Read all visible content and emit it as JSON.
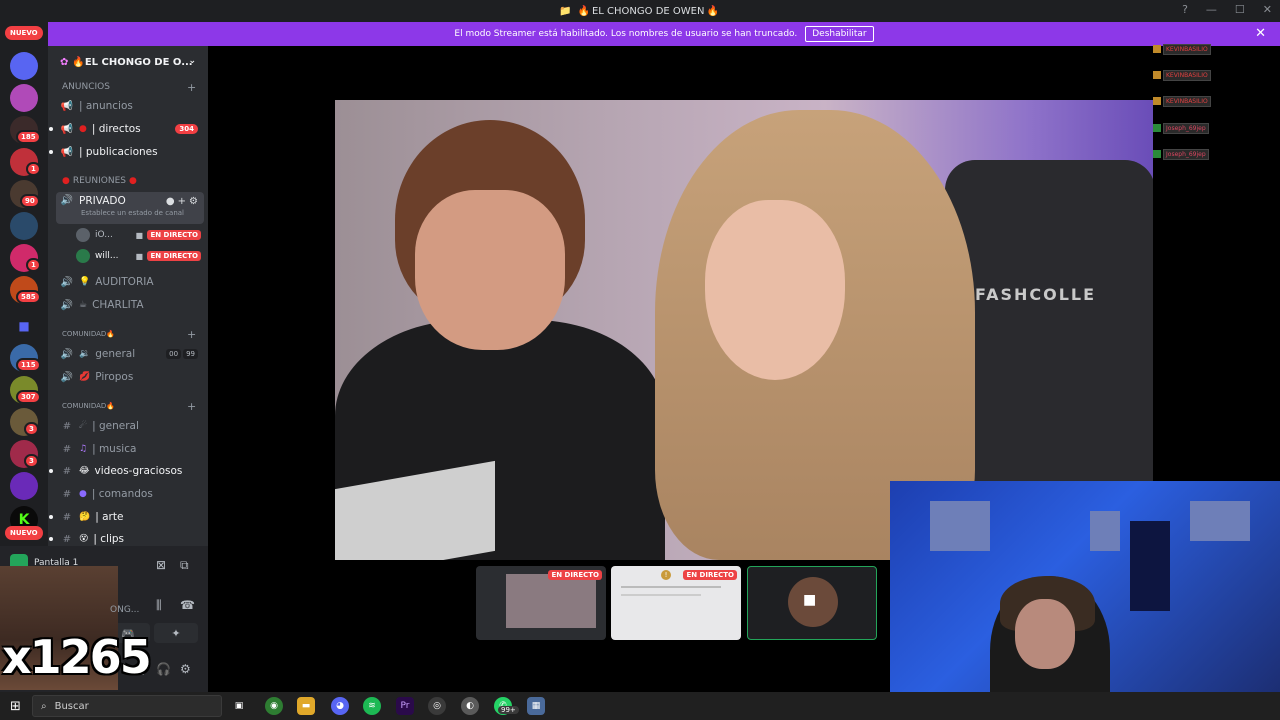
{
  "window": {
    "title": "EL CHONGO DE OWEN"
  },
  "banner": {
    "message": "El modo Streamer está habilitado. Los nombres de usuario se han truncado.",
    "button_label": "Deshabilitar"
  },
  "rail": {
    "nuevo_top": "NUEVO",
    "nuevo_bottom": "NUEVO",
    "badges": [
      "185",
      "1",
      "90",
      "1",
      "585",
      "115",
      "307",
      "3",
      "3"
    ]
  },
  "sidebar": {
    "server_name": "🔥EL CHONGO DE O...",
    "categories": {
      "anuncios": "ANUNCIOS",
      "reuniones": "REUNIONES",
      "comunidad1": "COMUNIDAD🔥",
      "comunidad2": "COMUNIDAD🔥"
    },
    "channels": {
      "anuncios": "| anuncios",
      "directos": "| directos",
      "directos_badge": "304",
      "publicaciones": "| publicaciones",
      "privado": "PRIVADO",
      "privado_status": "Establece un estado de canal",
      "auditoria": "AUDITORIA",
      "charlita": "CHARLITA",
      "general_voice": "general",
      "general_voice_count1": "00",
      "general_voice_count2": "99",
      "piropos": "Piropos",
      "general_text": "| general",
      "musica": "| musica",
      "videos": "videos-graciosos",
      "comandos": "| comandos",
      "arte": "| arte",
      "clips": "| clips"
    },
    "voice_users": [
      {
        "name": "iO...",
        "status": "EN DIRECTO"
      },
      {
        "name": "will...",
        "status": "EN DIRECTO"
      }
    ]
  },
  "userpanel": {
    "screen_label": "Pantalla 1",
    "ong_text": "ONG...",
    "counter": "x1265"
  },
  "chat_overlay": [
    {
      "name": "KEVINBASILIO"
    },
    {
      "name": "KEVINBASILIO"
    },
    {
      "name": "KEVINBASILIO"
    },
    {
      "name": "Joseph_69jep"
    },
    {
      "name": "Joseph_69jep"
    }
  ],
  "thumbnails": {
    "live1": "EN DIRECTO",
    "live2": "EN DIRECTO"
  },
  "video": {
    "chair_text": "FASHCOLLE"
  },
  "taskbar": {
    "search_placeholder": "Buscar",
    "whatsapp_badge": "99+"
  },
  "colors": {
    "banner": "#8d38e8",
    "live": "#ed4245",
    "badge": "#f23f43",
    "sidebar": "#2b2d31"
  }
}
